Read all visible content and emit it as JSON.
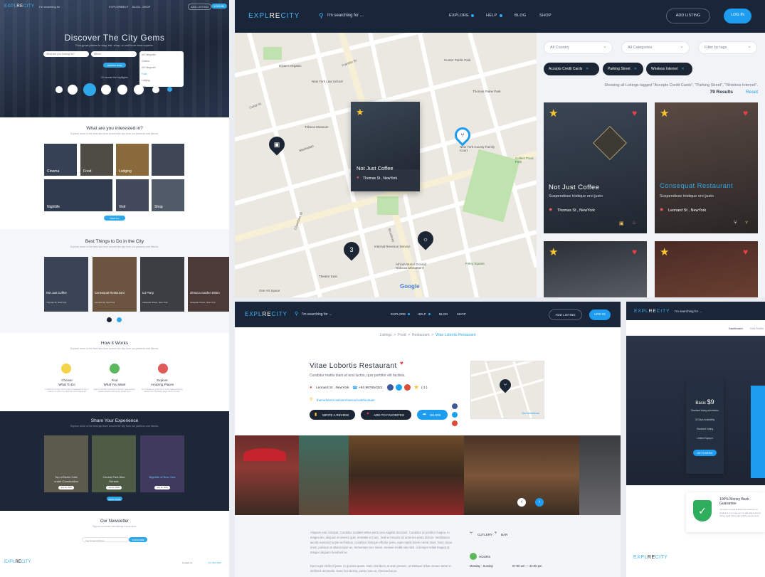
{
  "left": {
    "logo": {
      "a": "EXPL",
      "b": "RE",
      "c": "CITY"
    },
    "search_placeholder": "I'm searching for ...",
    "nav": [
      "EXPLORE",
      "HELP",
      "BLOG",
      "SHOP"
    ],
    "add_listing": "ADD LISTING",
    "login": "LOG IN",
    "hero_title": "Discover The City Gems",
    "hero_sub": "Find great places to stay, eat, shop, or visit from local experts.",
    "what_input": "What are you looking for?",
    "where_input": "Where",
    "search_btn": "SEARCH NOW",
    "dropdown_items": [
      "All Categories",
      "Cinema",
      "All Categories",
      "Food",
      "Lodging",
      "Visit"
    ],
    "highlights_label": "Or browse the highlights",
    "interest_title": "What are you interested in?",
    "interest_sub": "Explore some of the best tips from around the city from our partners and friends.",
    "categories": [
      "Cinema",
      "Food",
      "Lodging",
      "Nightlife",
      "Visit",
      "Shop"
    ],
    "view_all": "VIEW ALL",
    "best_title": "Best Things to Do in the City",
    "best_sub": "Explore some of the best tips from around the city from our partners and friends.",
    "things": [
      {
        "t": "Not Just Coffee",
        "s": "Thomas St, NewYork"
      },
      {
        "t": "Consequat Restaurant",
        "s": "Leonard St, NewYork"
      },
      {
        "t": "DJ Party",
        "s": "Lafayette Street, New York"
      },
      {
        "t": "Zinsuca Garden Bistro",
        "s": "Lafayette Street, New York"
      }
    ],
    "how_title": "How it Works",
    "how_sub": "Explore some of the best tips from around the city from our partners and friends.",
    "how_steps": [
      {
        "t": "Choose",
        "s": "What To Do",
        "d": "Looking for a cozy hotel to stay, a restaurant to eat, a museum to visit or a mall to do some shopping?"
      },
      {
        "t": "Find",
        "s": "What You Want",
        "d": "Search and filter hundreds of listings, read reviews, explore photos and find the perfect spot."
      },
      {
        "t": "Explore",
        "s": "Amazing Places",
        "d": "Go and have a good time or even make a booking directly from the listing page. All of it for free."
      }
    ],
    "share_title": "Share Your Experience",
    "share_sub": "Explore some of the best tips from around the city from our partners and friends.",
    "experiences": [
      {
        "t": "Top of Berlin Cafe",
        "s": "under Construction",
        "d": "July 23, 2018"
      },
      {
        "t": "Central Park Bike",
        "s": "Rentals",
        "d": "July 20, 2018"
      },
      {
        "t": "Nightlife of New York",
        "s": "",
        "d": "July 16, 2018"
      }
    ],
    "read_more": "READ MORE",
    "newsletter_title": "Our Newsletter",
    "newsletter_sub": "Sign up to receive new listings in your area.",
    "newsletter_placeholder": "Your Email Address",
    "subscribe": "SUBSCRIBE",
    "footer_contact": "Contact us",
    "footer_phone": "123-456-7890"
  },
  "top": {
    "logo": {
      "a": "EXPL",
      "b": "RE",
      "c": "CITY"
    },
    "search_placeholder": "I'm searching for ...",
    "nav": [
      "EXPLORE",
      "HELP",
      "BLOG",
      "SHOP"
    ],
    "add_listing": "ADD LISTING",
    "login": "LOG IN",
    "map_popup": {
      "title": "Not Just Coffee",
      "address": "Thomas St , NewYork"
    },
    "map_cluster": "3",
    "map_labels": [
      "Dylan's Organic",
      "New York Law School",
      "Tribeca Museum",
      "Hunter Public Park",
      "Thomas Paine Park",
      "New York County Family Court",
      "Collect Pond Park",
      "Internal Revenue Service",
      "African Burial Ground National Monument",
      "Foley Square",
      "Chambers St",
      "Theatre East",
      "One Art Space",
      "Manhattan",
      "Broadway",
      "Franklin St",
      "Canal St"
    ],
    "google": "Google",
    "filters": {
      "country": "All Country",
      "categories": "All Categories",
      "tags": "Filter by tags"
    },
    "chips": [
      "Accepts Credit Cards",
      "Parking Street",
      "Wireless Internet"
    ],
    "results_info": "Showing all Listings tagged \"Accepts Credit Cards\", \"Parking Street\", \"Wireless Internet\".",
    "results_count": "79 Results",
    "reset": "Reset",
    "cards": [
      {
        "title": "Not Just Coffee",
        "sub": "Suspendisse tristique orci justo",
        "addr": "Thomas St , NewYork"
      },
      {
        "title": "Consequat Restaurant",
        "sub": "Suspendisse tristique orci justo",
        "addr": "Leonard St , NewYork"
      }
    ]
  },
  "detail": {
    "logo": {
      "a": "EXPL",
      "b": "RE",
      "c": "CITY"
    },
    "search_placeholder": "I'm searching for ...",
    "nav": [
      "EXPLORE",
      "HELP",
      "BLOG",
      "SHOP"
    ],
    "add_listing": "ADD LISTING",
    "login": "LOG IN",
    "crumbs": [
      "Listings",
      "Food",
      "Restaurant",
      "Vitae Lobortis Restaurant"
    ],
    "title": "Vitae Lobortis Restaurant",
    "subtitle": "Curabitur mattis diam et erat luctus, quis porttitor elit facilisis.",
    "address": "Leonard St , NewYork",
    "phone": "+84 987654321",
    "rating": "( 3 )",
    "website": "themeforest.net/user/nasca/codefountain",
    "btn_review": "WRITE A REVIEW",
    "btn_fav": "ADD TO FAVORITES",
    "btn_share": "SHARE",
    "map_link": "Get directions",
    "desc1": "Aliquam erat volutpat. Curabitur sodales tellus porta arcu sagittis tincidunt. Curabitur at porttitor magna. In magna leo, aliquam in viverra quis, molestie et nunc. Sed vel mauris sit amet leo porta dictum. Vestibulum iaculis euismod turpis vel finibus. Curabitur tristique efficitur justo, eget mattis lorem nisl at risus. Nunc lacus enim, pulvinar at ullamcorper ac, fermentum nec lorem. Aenean mollis nisi nibh, ut tempor tellus feugiat at. Integer aliquam hendrerit ex.",
    "desc2": "Nam eget eleifend justo. In gravida quam. Nam nisi libero at ante pretium, at tristique tellus. Donec tortor in eleifend commodo. Nunc leo lacinia, porta nunc at, rhoncus lacus.",
    "amenities": [
      "CUTLERY",
      "BAR"
    ],
    "hours_label": "HOURS",
    "hours_row": {
      "days": "Monday - Sunday",
      "time": "07:00 am — 22:00 pm"
    }
  },
  "dash": {
    "logo": {
      "a": "EXPL",
      "b": "RE",
      "c": "CITY"
    },
    "search_placeholder": "I'm searching for ...",
    "crumb": "Dashboard",
    "crumb2": "Edit Profile",
    "plan_name": "Basic",
    "plan_price": "$9",
    "plan_features": [
      "Standard listing submission",
      "30 Days Availability",
      "Standard Listing",
      "Limited Support"
    ],
    "plan_btn": "GET STARTED",
    "guarantee_title": "100% Money Back Guarantee",
    "guarantee_text": "You have to know at least how amazing our product is. If you are not, we will refund all your money back. Don't wait until the deal is done."
  }
}
